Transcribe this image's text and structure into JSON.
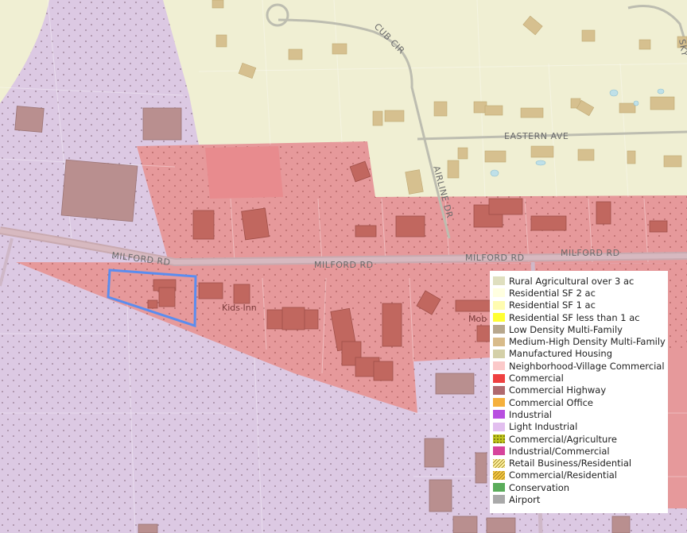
{
  "map": {
    "streets": {
      "milford_1": "MILFORD RD",
      "milford_2": "MILFORD RD",
      "milford_3": "MILFORD RD",
      "milford_4": "MILFORD RD",
      "cub": "CUB CIR",
      "eastern": "EASTERN AVE",
      "airline": "AIRLINE DR",
      "sky": "SKY"
    },
    "places": {
      "kids_inn": "Kids Inn",
      "mob": "Mob"
    },
    "colors": {
      "light_industrial": "#dcc9e3",
      "commercial": "#e6999b",
      "rural": "#f0efd3",
      "building": "#c1675f",
      "selection": "#5b8def"
    }
  },
  "legend": {
    "items": [
      {
        "label": "Rural Agricultural over 3 ac",
        "color": "#dfdfbf",
        "pattern": "solid"
      },
      {
        "label": "Residential SF 2 ac",
        "color": "#ffffe0",
        "pattern": "solid"
      },
      {
        "label": "Residential SF 1 ac",
        "color": "#fffcb0",
        "pattern": "solid"
      },
      {
        "label": "Residential SF less than 1 ac",
        "color": "#ffff33",
        "pattern": "solid"
      },
      {
        "label": "Low Density Multi-Family",
        "color": "#b7a78d",
        "pattern": "solid"
      },
      {
        "label": "Medium-High Density Multi-Family",
        "color": "#d8bb8a",
        "pattern": "solid"
      },
      {
        "label": "Manufactured Housing",
        "color": "#d4d0a8",
        "pattern": "solid"
      },
      {
        "label": "Neighborhood-Village Commercial",
        "color": "#fbc9c9",
        "pattern": "solid"
      },
      {
        "label": "Commercial",
        "color": "#ef4141",
        "pattern": "solid"
      },
      {
        "label": "Commercial Highway",
        "color": "#b06a6e",
        "pattern": "solid"
      },
      {
        "label": "Commercial Office",
        "color": "#f5b03c",
        "pattern": "solid"
      },
      {
        "label": "Industrial",
        "color": "#b84fe0",
        "pattern": "solid"
      },
      {
        "label": "Light Industrial",
        "color": "#e2bfef",
        "pattern": "solid"
      },
      {
        "label": "Commercial/Agriculture",
        "color": "#bfc41c",
        "pattern": "dots"
      },
      {
        "label": "Industrial/Commercial",
        "color": "#d6449c",
        "pattern": "solid"
      },
      {
        "label": "Retail Business/Residential",
        "color": "#fff4a0",
        "pattern": "hatch"
      },
      {
        "label": "Commercial/Residential",
        "color": "#f7c843",
        "pattern": "hatch"
      },
      {
        "label": "Conservation",
        "color": "#5aac5a",
        "pattern": "solid"
      },
      {
        "label": "Airport",
        "color": "#a9a9a9",
        "pattern": "solid"
      }
    ]
  }
}
